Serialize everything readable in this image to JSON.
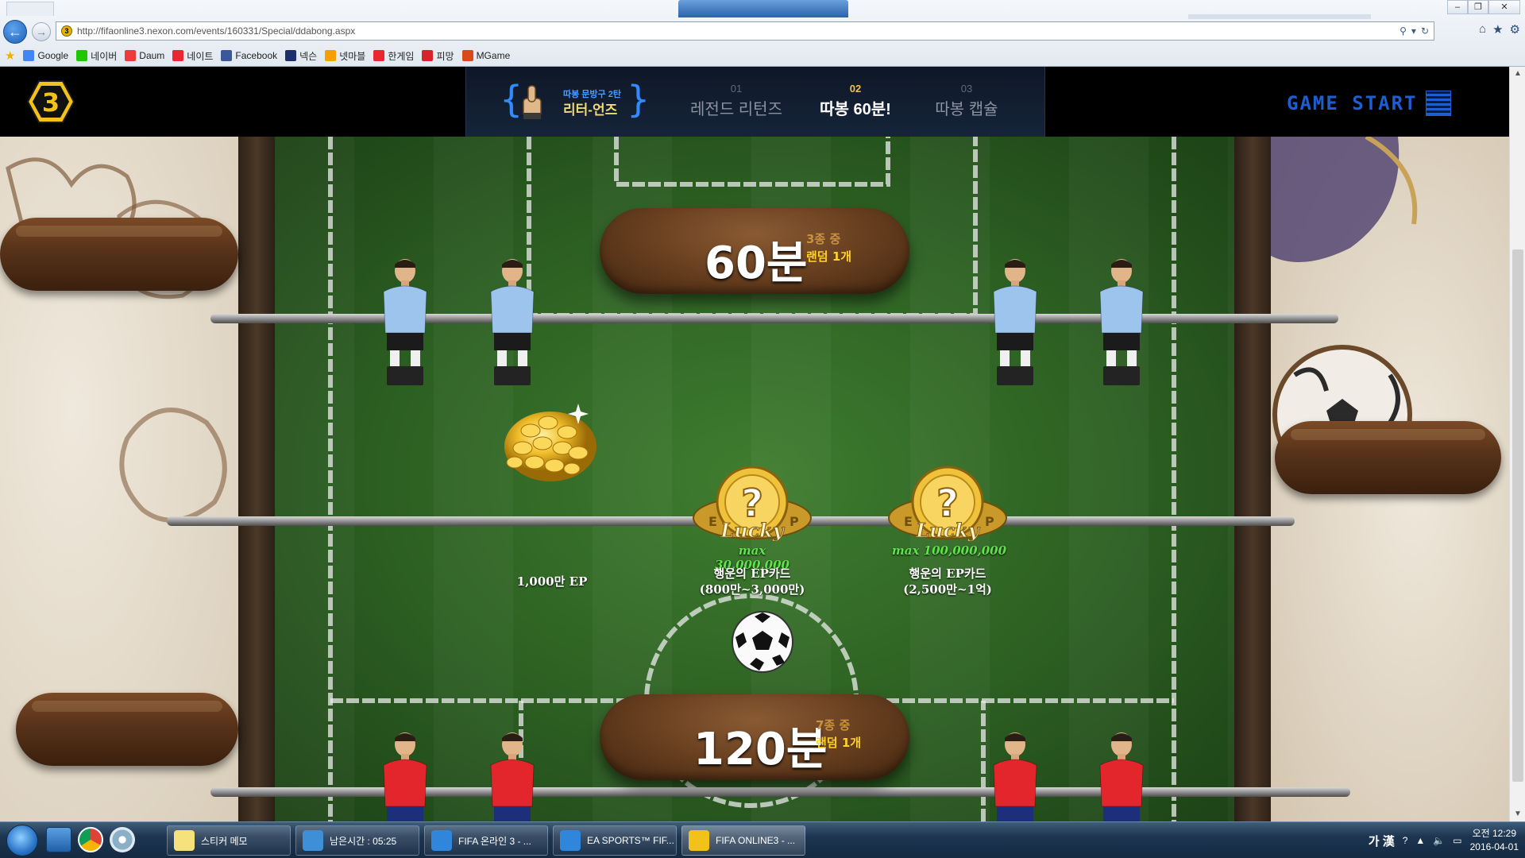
{
  "browser": {
    "url": "http://fifaonline3.nexon.com/events/160331/Special/ddabong.aspx",
    "favorites": [
      {
        "label": "Google",
        "icon": "google-icon",
        "color": "#4285f4"
      },
      {
        "label": "네이버",
        "icon": "naver-icon",
        "color": "#1ec800"
      },
      {
        "label": "Daum",
        "icon": "daum-icon",
        "color": "#ee3b3b"
      },
      {
        "label": "네이트",
        "icon": "nate-icon",
        "color": "#e8272e"
      },
      {
        "label": "Facebook",
        "icon": "facebook-icon",
        "color": "#3b5998"
      },
      {
        "label": "넥슨",
        "icon": "nexon-icon",
        "color": "#1a2f6b"
      },
      {
        "label": "넷마블",
        "icon": "netmarble-icon",
        "color": "#f5a000"
      },
      {
        "label": "한게임",
        "icon": "hangame-icon",
        "color": "#e8272e"
      },
      {
        "label": "피망",
        "icon": "pmang-icon",
        "color": "#d8232a"
      },
      {
        "label": "MGame",
        "icon": "mgame-icon",
        "color": "#d84a1b"
      }
    ]
  },
  "header": {
    "logo": "3",
    "badge_sub": "따봉 문방구 2탄",
    "badge_main": "리터-언즈",
    "tabs": [
      {
        "num": "01",
        "label": "레전드 리턴즈",
        "active": false
      },
      {
        "num": "02",
        "label": "따봉 60분!",
        "active": true
      },
      {
        "num": "03",
        "label": "따봉 캡슐",
        "active": false
      }
    ],
    "game_start": "GAME START"
  },
  "table": {
    "top_plaque": {
      "big": "60분",
      "count": "3종 중",
      "random": "랜덤 1개"
    },
    "bottom_plaque": {
      "big": "120분",
      "count": "7종 중",
      "random": "랜덤 1개"
    },
    "rewards": [
      {
        "label": "1,000만 EP",
        "icon": "gold-coins-icon"
      },
      {
        "label_line1": "행운의 EP카드",
        "label_line2": "(800만~3,000만)",
        "max": "max 30,000,000",
        "icon": "lucky-ep-coin-icon",
        "lucky": "Lucky"
      },
      {
        "label_line1": "행운의 EP카드",
        "label_line2": "(2,500만~1억)",
        "max": "max 100,000,000",
        "icon": "lucky-ep-coin-icon",
        "lucky": "Lucky"
      }
    ],
    "colors": {
      "team_top": "#9cc4ec",
      "team_bottom": "#e3262b",
      "field": "#2c5f22"
    }
  },
  "taskbar": {
    "tasks": [
      {
        "label": "스티커 메모",
        "icon": "sticky-notes-icon"
      },
      {
        "label": "남은시간 : 05:25",
        "icon": "mult-icon"
      },
      {
        "label": "FIFA 온라인 3 - ...",
        "icon": "ie-icon"
      },
      {
        "label": "EA SPORTS™ FIF...",
        "icon": "ie-icon"
      },
      {
        "label": "FIFA ONLINE3 - ...",
        "icon": "fifa-online3-icon"
      }
    ],
    "ime": "가 漢",
    "clock_time": "오전 12:29",
    "clock_date": "2016-04-01"
  }
}
